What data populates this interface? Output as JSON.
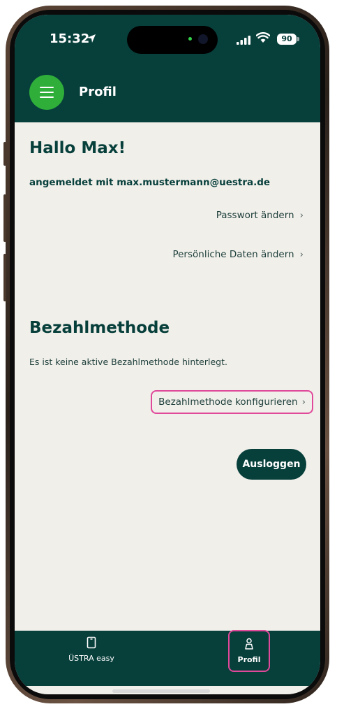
{
  "status_bar": {
    "time": "15:32",
    "battery": "90"
  },
  "header": {
    "title": "Profil"
  },
  "profile": {
    "greeting": "Hallo Max!",
    "signed_in_text": "angemeldet mit max.mustermann@uestra.de",
    "change_password": "Passwort ändern",
    "change_personal_data": "Persönliche Daten ändern"
  },
  "payment": {
    "title": "Bezahlmethode",
    "info": "Es ist keine aktive Bezahlmethode hinterlegt.",
    "configure": "Bezahlmethode konfigurieren"
  },
  "logout_label": "Ausloggen",
  "tabbar": {
    "tabs": [
      {
        "label": "ÜSTRA easy",
        "icon": "phone-icon"
      },
      {
        "label": "Profil",
        "icon": "person-icon"
      }
    ]
  },
  "colors": {
    "primary": "#073f3b",
    "accent": "#2fae3a",
    "highlight": "#e0489a",
    "background": "#f1efea"
  }
}
